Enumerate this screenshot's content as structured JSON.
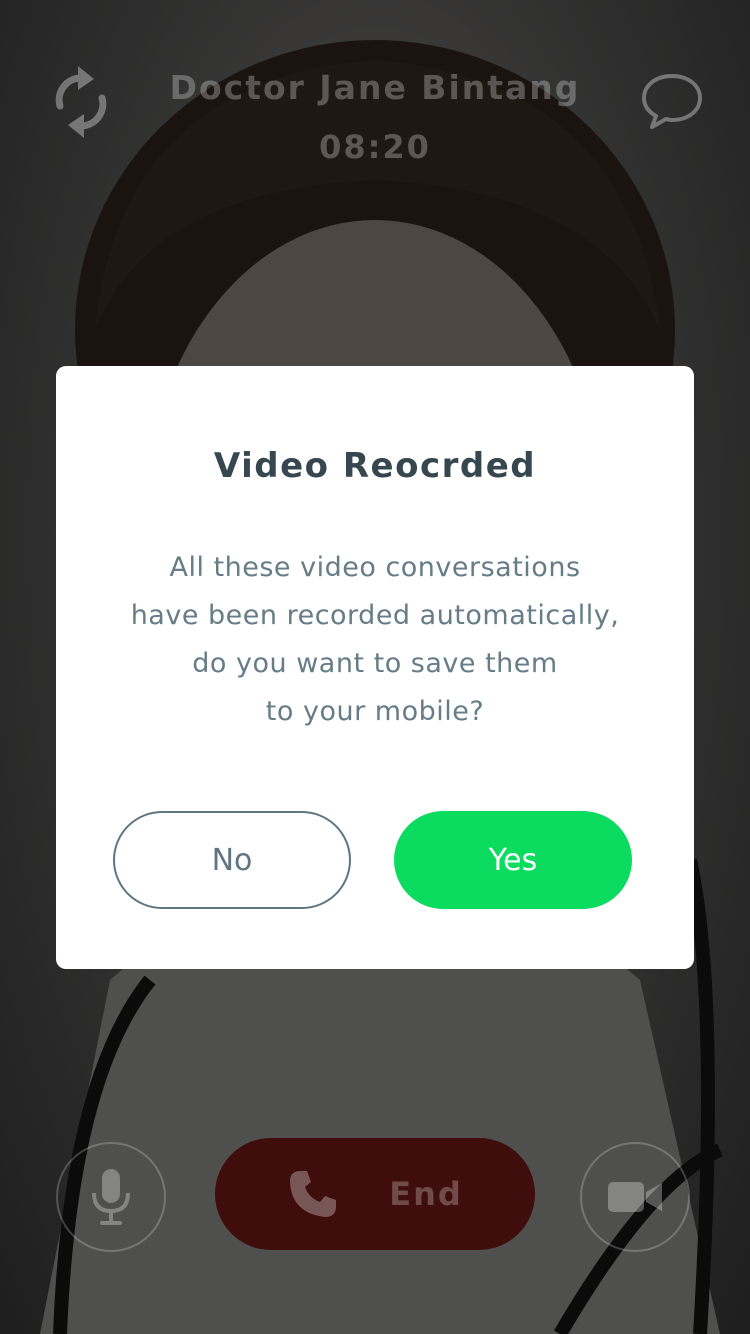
{
  "call": {
    "caller_name": "Doctor Jane Bintang",
    "timer": "08:20",
    "end_label": "End"
  },
  "dialog": {
    "title": "Video Reocrded",
    "message_lines": [
      "All these video conversations",
      "have been recorded automatically,",
      "do you want to save them",
      "to your mobile?"
    ],
    "no_label": "No",
    "yes_label": "Yes"
  },
  "icons": {
    "switch_camera": "switch-camera-icon",
    "chat": "chat-bubble-icon",
    "mic": "microphone-icon",
    "phone": "phone-icon",
    "camera": "video-camera-icon"
  },
  "colors": {
    "accent_green": "#0bdc5f",
    "end_red": "#3f0d0c",
    "title_text": "#37474f",
    "body_text": "#667c86"
  }
}
